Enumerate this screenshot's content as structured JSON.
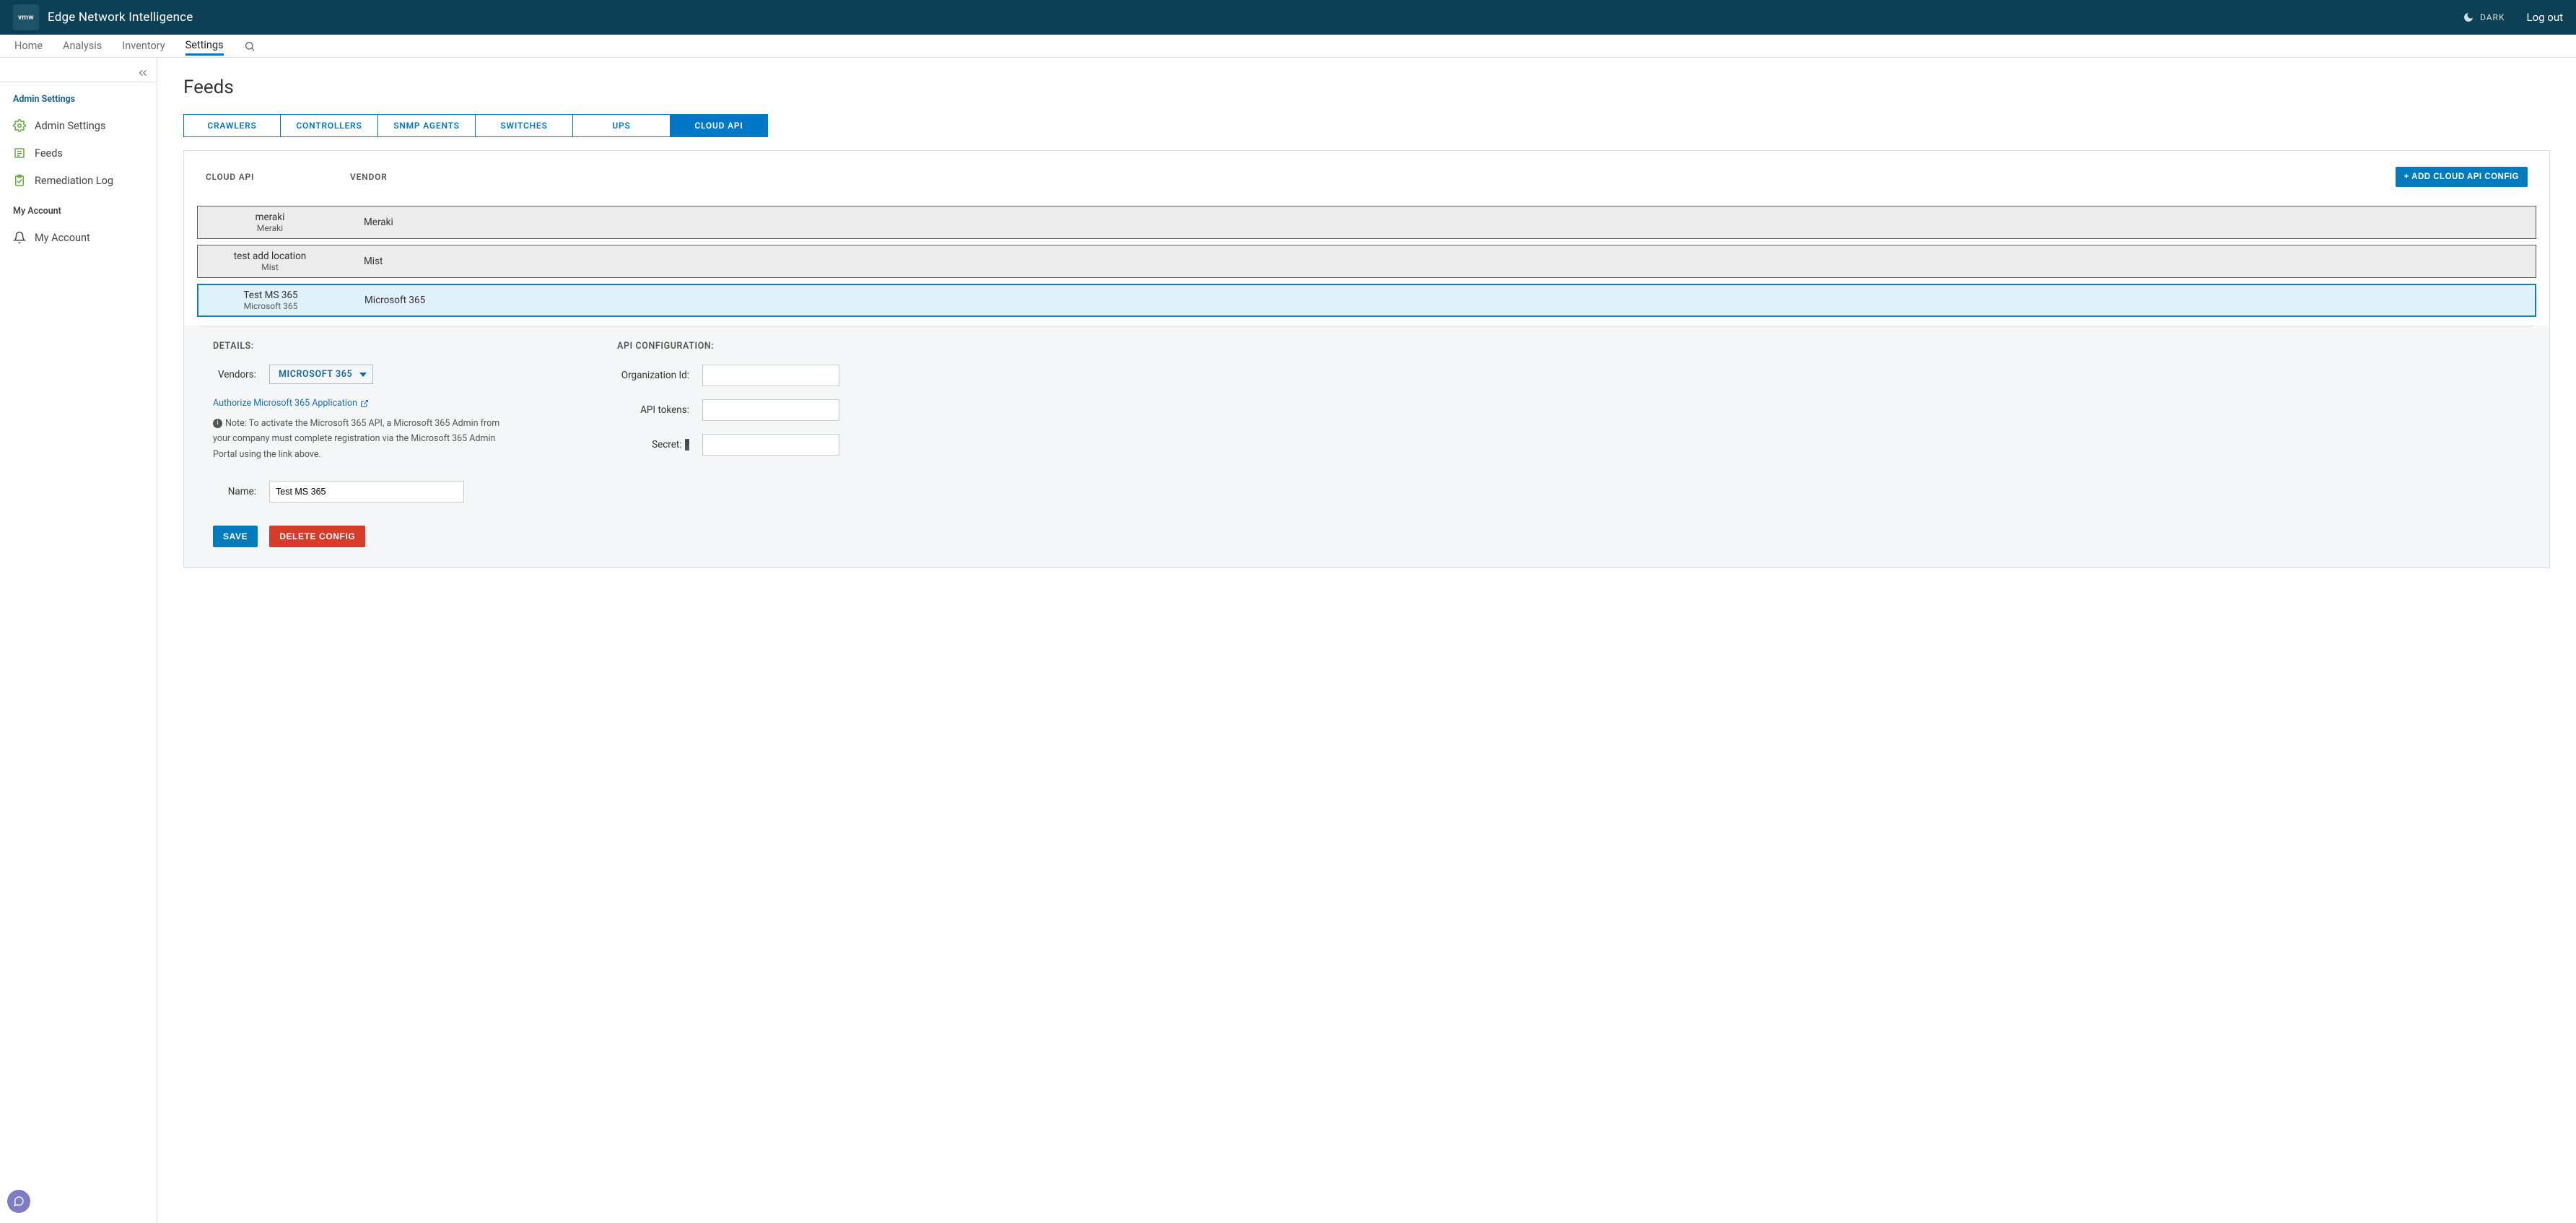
{
  "brand": {
    "logo_text": "vmw",
    "title": "Edge Network Intelligence"
  },
  "topbar": {
    "dark_label": "DARK",
    "logout_label": "Log out"
  },
  "mainnav": {
    "items": [
      {
        "label": "Home"
      },
      {
        "label": "Analysis"
      },
      {
        "label": "Inventory"
      },
      {
        "label": "Settings",
        "active": true
      }
    ]
  },
  "sidebar": {
    "section1_title": "Admin Settings",
    "items1": [
      {
        "label": "Admin Settings"
      },
      {
        "label": "Feeds"
      },
      {
        "label": "Remediation Log"
      }
    ],
    "section2_title": "My Account",
    "items2": [
      {
        "label": "My Account"
      }
    ]
  },
  "page": {
    "title": "Feeds"
  },
  "feed_tabs": [
    {
      "label": "CRAWLERS"
    },
    {
      "label": "CONTROLLERS"
    },
    {
      "label": "SNMP AGENTS"
    },
    {
      "label": "SWITCHES"
    },
    {
      "label": "UPS"
    },
    {
      "label": "CLOUD API",
      "active": true
    }
  ],
  "table": {
    "col_api": "CLOUD API",
    "col_vendor": "VENDOR",
    "add_button": "+ ADD CLOUD API CONFIG",
    "rows": [
      {
        "name": "meraki",
        "sub": "Meraki",
        "vendor": "Meraki",
        "selected": false
      },
      {
        "name": "test add location",
        "sub": "Mist",
        "vendor": "Mist",
        "selected": false
      },
      {
        "name": "Test MS 365",
        "sub": "Microsoft 365",
        "vendor": "Microsoft 365",
        "selected": true
      }
    ]
  },
  "details": {
    "details_title": "DETAILS:",
    "api_title": "API CONFIGURATION:",
    "vendor_label": "Vendors:",
    "vendor_value": "MICROSOFT 365",
    "auth_link": "Authorize Microsoft 365 Application",
    "note_text": "Note: To activate the Microsoft 365 API, a Microsoft 365 Admin from your company must complete registration via the Microsoft 365 Admin Portal using the link above.",
    "name_label": "Name:",
    "name_value": "Test MS 365",
    "org_label": "Organization Id:",
    "org_value": "",
    "tokens_label": "API tokens:",
    "tokens_value": "",
    "secret_label": "Secret:",
    "secret_value": ""
  },
  "buttons": {
    "save": "SAVE",
    "delete": "DELETE CONFIG"
  }
}
